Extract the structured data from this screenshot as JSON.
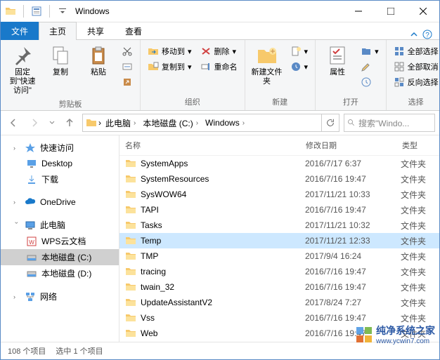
{
  "window": {
    "title": "Windows"
  },
  "ribbon": {
    "tabs": [
      "文件",
      "主页",
      "共享",
      "查看"
    ],
    "groups": {
      "clipboard": "剪贴板",
      "organize": "组织",
      "new": "新建",
      "open": "打开",
      "select": "选择"
    },
    "clipboard": {
      "pin": "固定到\"快速访问\"",
      "copy": "复制",
      "paste": "粘贴"
    },
    "organize": {
      "move": "移动到",
      "copyto": "复制到",
      "delete": "删除",
      "rename": "重命名"
    },
    "new": {
      "folder": "新建文件夹"
    },
    "open": {
      "properties": "属性"
    },
    "select": {
      "all": "全部选择",
      "none": "全部取消",
      "invert": "反向选择"
    }
  },
  "breadcrumb": [
    "此电脑",
    "本地磁盘 (C:)",
    "Windows"
  ],
  "search": {
    "placeholder": "搜索\"Windo..."
  },
  "tree": {
    "quick_access": "快速访问",
    "desktop": "Desktop",
    "downloads": "下载",
    "onedrive": "OneDrive",
    "this_pc": "此电脑",
    "wps": "WPS云文档",
    "c_drive": "本地磁盘 (C:)",
    "d_drive": "本地磁盘 (D:)",
    "network": "网络"
  },
  "columns": {
    "name": "名称",
    "date": "修改日期",
    "type": "类型"
  },
  "folder_type": "文件夹",
  "items": [
    {
      "name": "SystemApps",
      "date": "2016/7/17 6:37",
      "selected": false
    },
    {
      "name": "SystemResources",
      "date": "2016/7/16 19:47",
      "selected": false
    },
    {
      "name": "SysWOW64",
      "date": "2017/11/21 10:33",
      "selected": false
    },
    {
      "name": "TAPI",
      "date": "2016/7/16 19:47",
      "selected": false
    },
    {
      "name": "Tasks",
      "date": "2017/11/21 10:32",
      "selected": false
    },
    {
      "name": "Temp",
      "date": "2017/11/21 12:33",
      "selected": true
    },
    {
      "name": "TMP",
      "date": "2017/9/4 16:24",
      "selected": false
    },
    {
      "name": "tracing",
      "date": "2016/7/16 19:47",
      "selected": false
    },
    {
      "name": "twain_32",
      "date": "2016/7/16 19:47",
      "selected": false
    },
    {
      "name": "UpdateAssistantV2",
      "date": "2017/8/24 7:27",
      "selected": false
    },
    {
      "name": "Vss",
      "date": "2016/7/16 19:47",
      "selected": false
    },
    {
      "name": "Web",
      "date": "2016/7/16 19:47",
      "selected": false
    }
  ],
  "status": {
    "count": "108 个项目",
    "selected": "选中 1 个项目"
  },
  "watermark": {
    "line1": "纯净系统之家",
    "line2": "www.ycwin7.com"
  }
}
